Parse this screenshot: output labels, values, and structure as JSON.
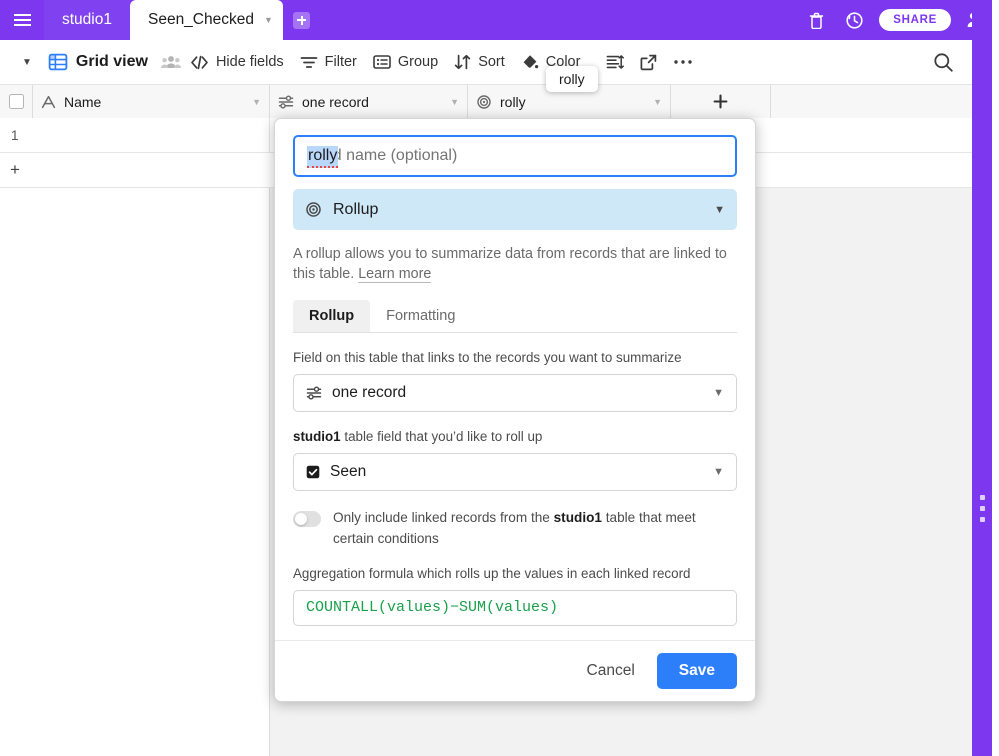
{
  "topbar": {
    "menu_icon": "hamburger-icon",
    "tabs": [
      {
        "label": "studio1",
        "active": false
      },
      {
        "label": "Seen_Checked",
        "active": true
      }
    ],
    "add_tab_icon": "plus-square-icon",
    "trash_icon": "trash-icon",
    "history_icon": "history-icon",
    "share_label": "SHARE",
    "people_icon": "people-icon",
    "brand_color": "#7c37ef"
  },
  "viewbar": {
    "collapse_caret": "caret-down-icon",
    "view_name": "Grid view",
    "view_icon": "grid-icon",
    "collaborators_icon": "collaborators-icon",
    "items": [
      {
        "label": "Hide fields",
        "icon": "hide-fields-icon"
      },
      {
        "label": "Filter",
        "icon": "filter-icon"
      },
      {
        "label": "Group",
        "icon": "group-icon"
      },
      {
        "label": "Sort",
        "icon": "sort-icon"
      },
      {
        "label": "Color",
        "icon": "color-icon"
      }
    ],
    "row_height_icon": "row-height-icon",
    "share_view_icon": "external-link-icon",
    "more_icon": "more-horizontal-icon",
    "search_icon": "search-icon"
  },
  "tooltip": {
    "text": "rolly"
  },
  "grid": {
    "columns": [
      {
        "label": "Name",
        "icon": "text-field-icon"
      },
      {
        "label": "one record",
        "icon": "link-field-icon"
      },
      {
        "label": "rolly",
        "icon": "rollup-field-icon"
      }
    ],
    "add_field_icon": "plus-icon",
    "rows": [
      {
        "number": "1",
        "name": "",
        "one_record": "",
        "rolly": ""
      }
    ],
    "add_row_icon": "plus-icon"
  },
  "dialog": {
    "name_value": "rolly",
    "name_placeholder": "Field name (optional)",
    "type": {
      "label": "Rollup",
      "icon": "rollup-field-icon"
    },
    "description": "A rollup allows you to summarize data from records that are linked to this table.",
    "learn_more": "Learn more",
    "tabs": [
      {
        "label": "Rollup",
        "active": true
      },
      {
        "label": "Formatting",
        "active": false
      }
    ],
    "link_field": {
      "label": "Field on this table that links to the records you want to summarize",
      "value": "one record",
      "icon": "link-field-icon"
    },
    "rollup_field": {
      "label_bold": "studio1",
      "label_rest": " table field that you’d like to roll up",
      "value": "Seen",
      "icon": "checkbox-field-icon"
    },
    "conditions": {
      "toggle_on": false,
      "text_before": "Only include linked records from the ",
      "text_bold": "studio1",
      "text_after": " table that meet certain conditions"
    },
    "formula": {
      "label": "Aggregation formula which rolls up the values in each linked record",
      "value": "COUNTALL(values)−SUM(values)"
    },
    "cancel_label": "Cancel",
    "save_label": "Save",
    "accent_color": "#2d7ff9"
  }
}
